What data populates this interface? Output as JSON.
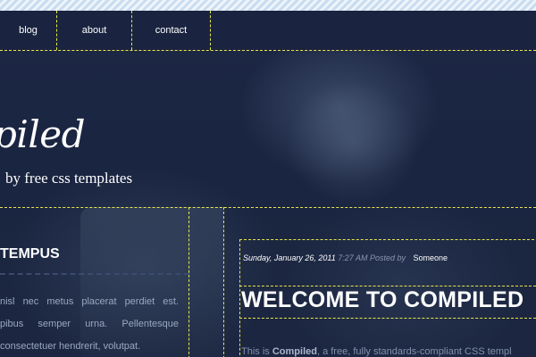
{
  "nav": {
    "items": [
      {
        "label": "blog"
      },
      {
        "label": "about"
      },
      {
        "label": "contact"
      }
    ]
  },
  "header": {
    "title": "piled",
    "tagline": "by free css templates"
  },
  "sidebar": {
    "heading": "TEMPUS",
    "lines": [
      "nisl nec metus placerat perdiet est.",
      "pibus semper urna. Pellentesque",
      "consectetuer hendrerit, volutpat."
    ]
  },
  "post": {
    "date": "Sunday, January 26, 2011",
    "time": "7:27 AM",
    "posted_by": "Posted by",
    "author": "Someone",
    "title": "WELCOME TO COMPILED",
    "excerpt_prefix": "This is ",
    "excerpt_name": "Compiled",
    "excerpt_suffix": ", a free, fully standards-compliant CSS templ"
  },
  "colors": {
    "background": "#1c2742",
    "accent_dashes": "#e8e84a",
    "text": "#ffffff"
  }
}
